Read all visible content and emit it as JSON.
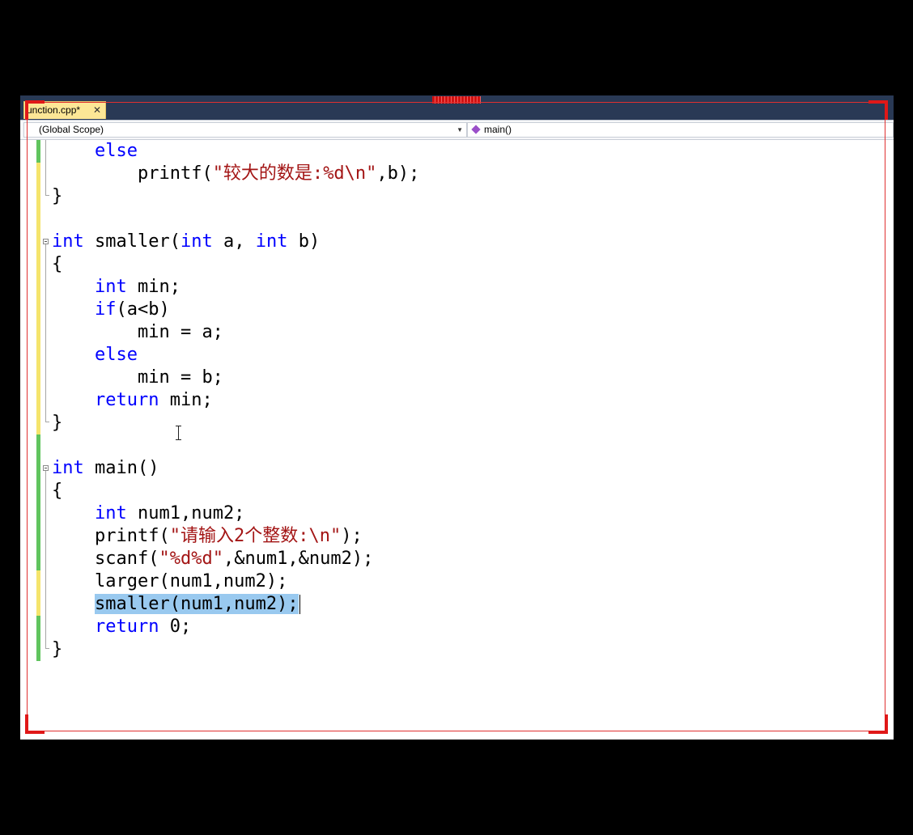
{
  "tab": {
    "title": "unction.cpp*",
    "close_glyph": "✕"
  },
  "navbar": {
    "scope": "(Global Scope)",
    "member": "main()"
  },
  "colors": {
    "keyword": "#0000ff",
    "string": "#a31515",
    "selection": "#99c9ef",
    "change_saved": "#60c45e",
    "change_unsaved": "#f5e46c"
  },
  "code": {
    "l1": {
      "t1": "else"
    },
    "l2": {
      "t1": "printf(",
      "t2": "\"较大的数是:",
      "t3": "%d\\n\"",
      "t4": ",b);"
    },
    "l3": {
      "t1": "}"
    },
    "l5": {
      "t1": "int",
      "t2": " smaller(",
      "t3": "int",
      "t4": " a, ",
      "t5": "int",
      "t6": " b)"
    },
    "l6": {
      "t1": "{"
    },
    "l7": {
      "t1": "int",
      "t2": " min;"
    },
    "l8": {
      "t1": "if",
      "t2": "(a<b)"
    },
    "l9": {
      "t1": "min = a;"
    },
    "l10": {
      "t1": "else"
    },
    "l11": {
      "t1": "min = b;"
    },
    "l12": {
      "t1": "return",
      "t2": " min;"
    },
    "l13": {
      "t1": "}"
    },
    "l15": {
      "t1": "int",
      "t2": " main()"
    },
    "l16": {
      "t1": "{"
    },
    "l17": {
      "t1": "int",
      "t2": " num1,num2;"
    },
    "l18": {
      "t1": "printf(",
      "t2": "\"请输入2个整数:",
      "t3": "\\n\"",
      "t4": ");"
    },
    "l19": {
      "t1": "scanf(",
      "t2": "\"",
      "t3": "%d%d",
      "t4": "\"",
      "t5": ",&num1,&num2);"
    },
    "l20": {
      "t1": "larger(num1,num2);"
    },
    "l21": {
      "t1": "smaller(num1,num2);"
    },
    "l22": {
      "t1": "return",
      "t2": " 0;"
    },
    "l23": {
      "t1": "}"
    }
  }
}
